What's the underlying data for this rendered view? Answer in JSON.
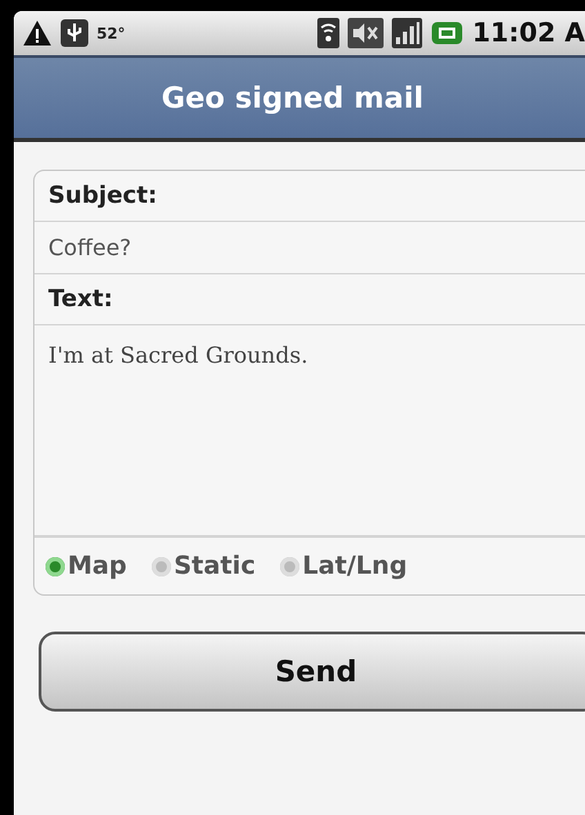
{
  "status_bar": {
    "temperature": "52°",
    "time": "11:02 A"
  },
  "window": {
    "title": "Geo signed mail"
  },
  "form": {
    "subject_label": "Subject:",
    "subject_value": "Coffee?",
    "text_label": "Text:",
    "text_value": "I'm at Sacred Grounds.",
    "location_options": [
      {
        "label": "Map",
        "selected": true
      },
      {
        "label": "Static",
        "selected": false
      },
      {
        "label": "Lat/Lng",
        "selected": false
      }
    ]
  },
  "buttons": [
    {
      "label": "Send"
    }
  ]
}
